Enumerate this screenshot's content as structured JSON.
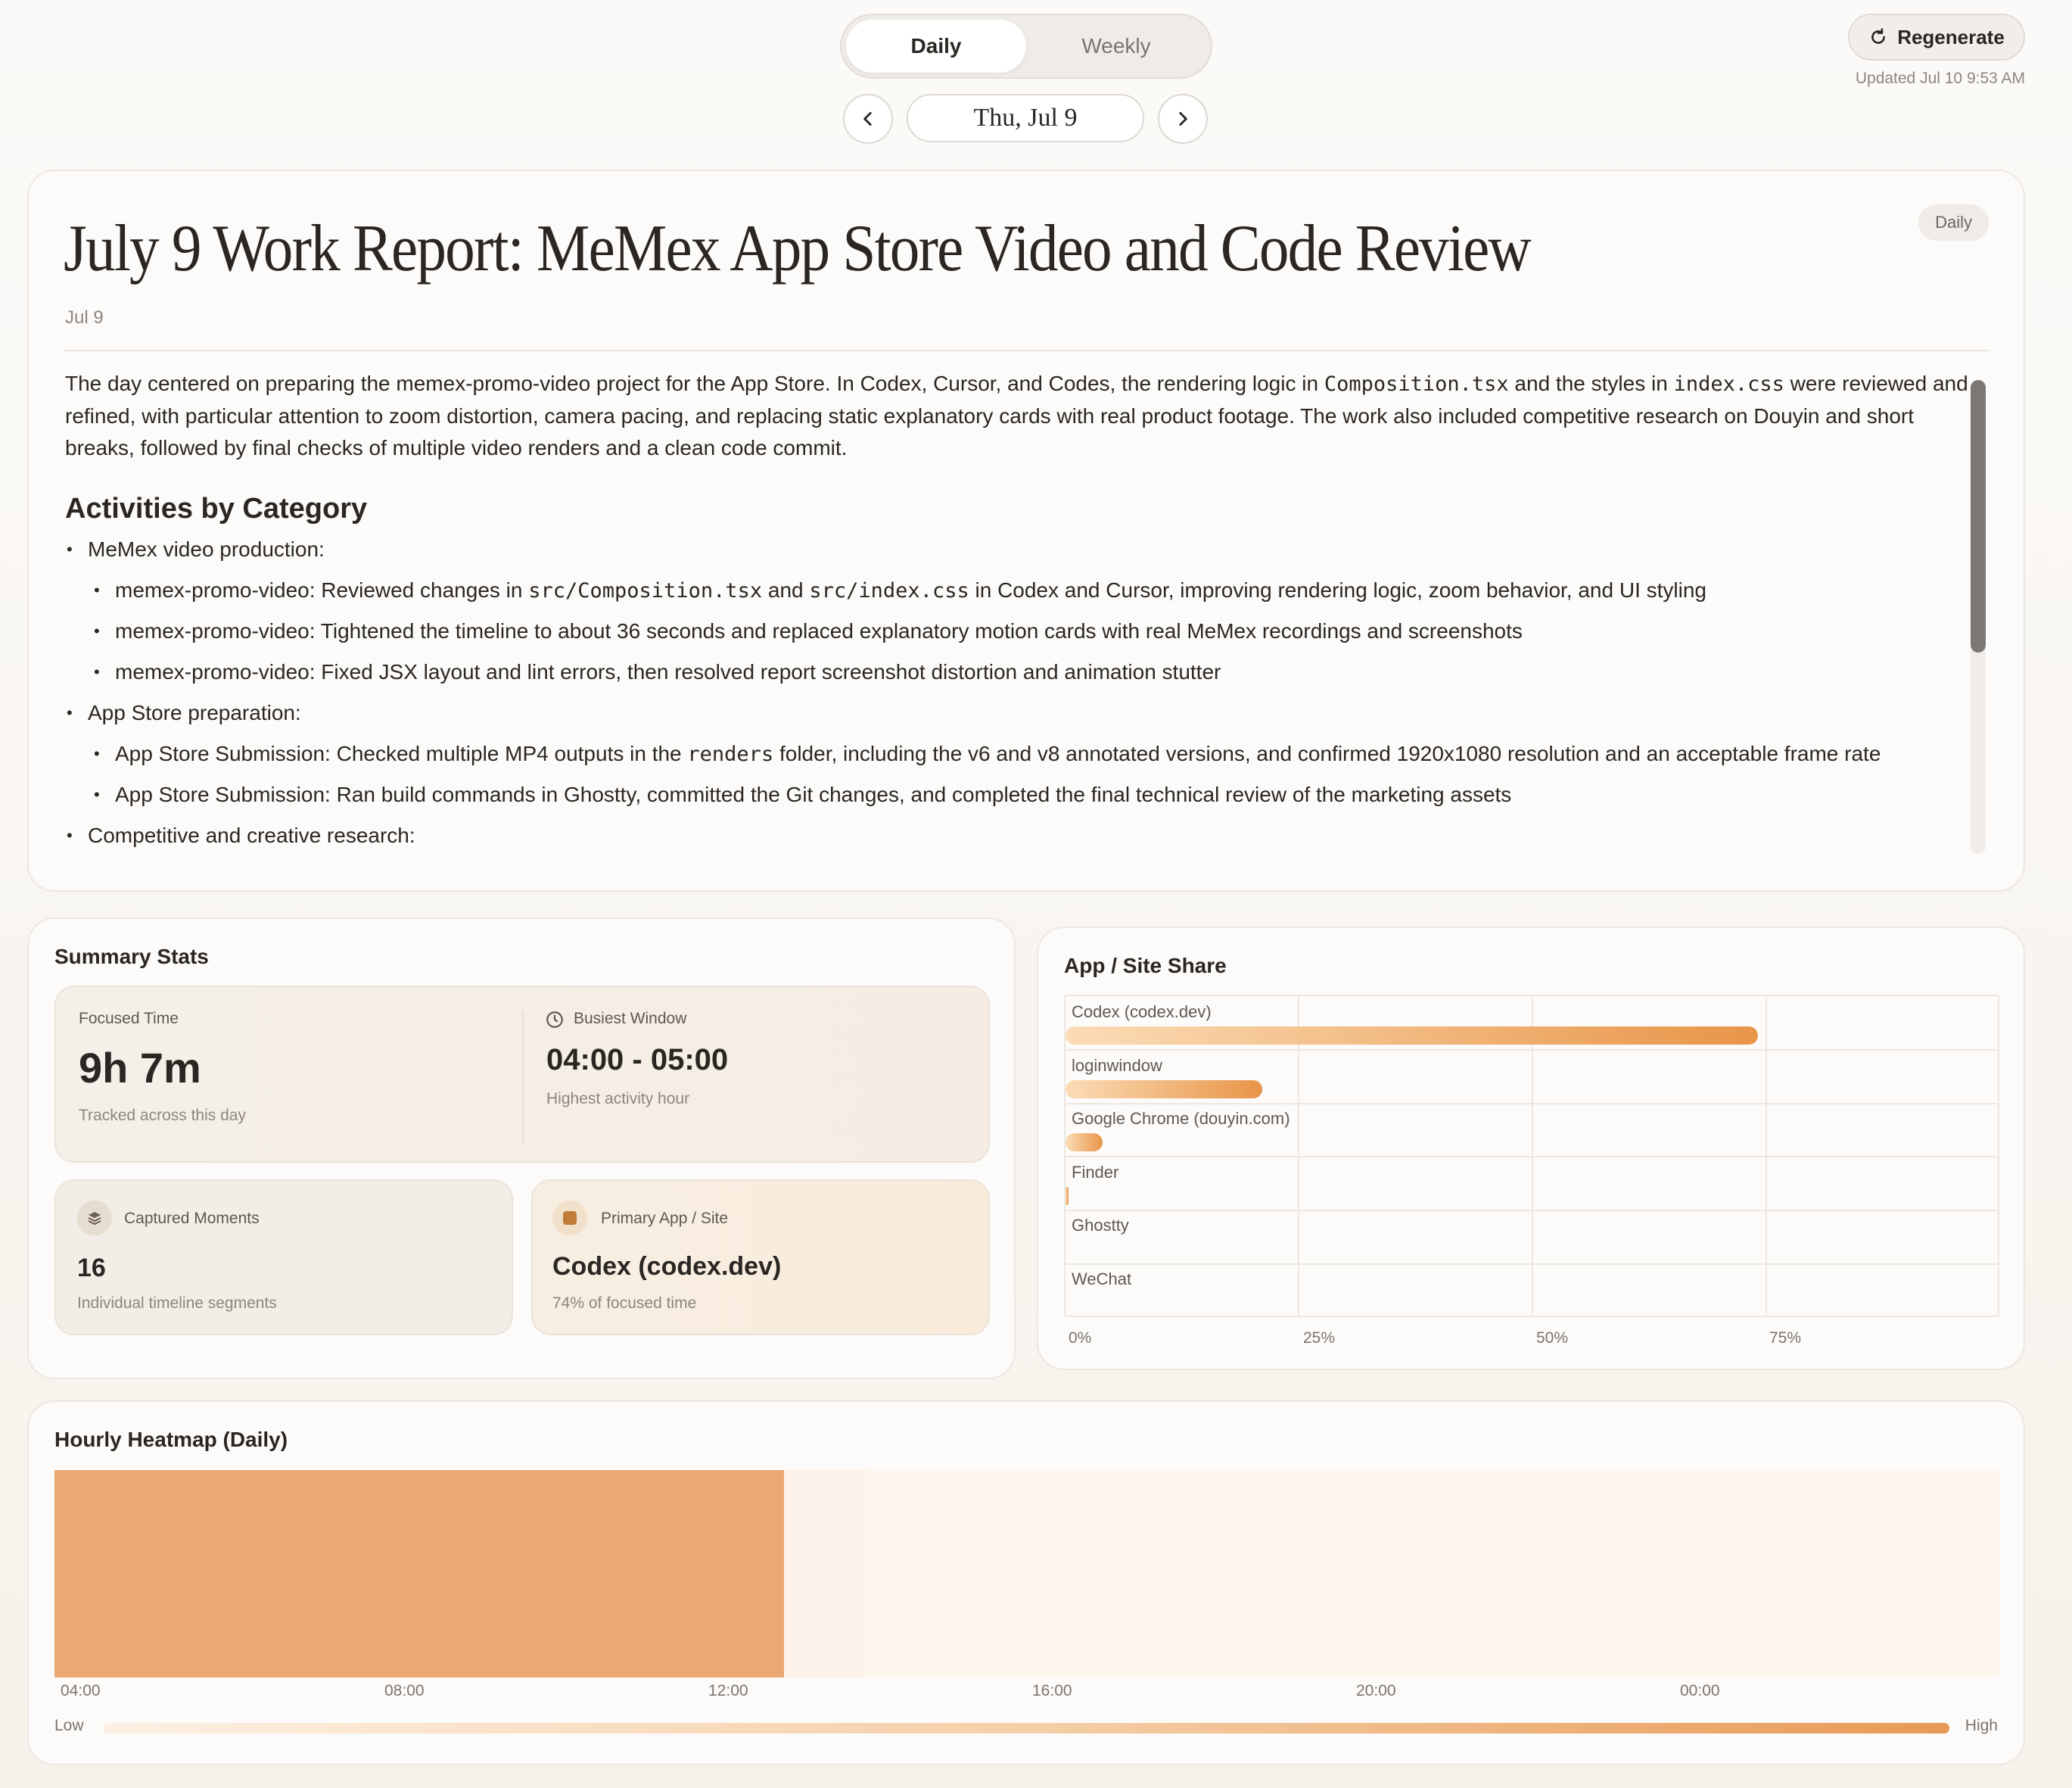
{
  "toggle": {
    "daily": "Daily",
    "weekly": "Weekly",
    "selected": "Daily"
  },
  "date_nav": {
    "label": "Thu, Jul 9",
    "prev_icon": "chevron-left-icon",
    "next_icon": "chevron-right-icon"
  },
  "regenerate": {
    "label": "Regenerate",
    "icon": "refresh-icon",
    "updated": "Updated Jul 10 9:53 AM"
  },
  "report": {
    "title": "July 9 Work Report: MeMex App Store Video and Code Review",
    "badge": "Daily",
    "date": "Jul 9",
    "summary": {
      "p1": "The day centered on preparing the memex-promo-video project for the App Store. In Codex, Cursor, and Codes, the rendering logic in ",
      "code1": "Composition.tsx",
      "p2": " and the styles in ",
      "code2": "index.css",
      "p3": " were reviewed and refined, with particular attention to zoom distortion, camera pacing, and replacing static explanatory cards with real product footage. The work also included competitive research on Douyin and short breaks, followed by final checks of multiple video renders and a clean code commit."
    },
    "activities_heading": "Activities by Category",
    "cat1": "MeMex video production:",
    "item1": {
      "a": "memex-promo-video: Reviewed changes in ",
      "code_a": "src/Composition.tsx",
      "b": " and ",
      "code_b": "src/index.css",
      "c": " in Codex and Cursor, improving rendering logic, zoom behavior, and UI styling"
    },
    "item2": "memex-promo-video: Tightened the timeline to about 36 seconds and replaced explanatory motion cards with real MeMex recordings and screenshots",
    "item3": "memex-promo-video: Fixed JSX layout and lint errors, then resolved report screenshot distortion and animation stutter",
    "cat2": "App Store preparation:",
    "item4": {
      "a": "App Store Submission: Checked multiple MP4 outputs in the ",
      "code_a": "renders",
      "b": " folder, including the v6 and v8 annotated versions, and confirmed 1920x1080 resolution and an acceptable frame rate"
    },
    "item5": "App Store Submission: Ran build commands in Ghostty, committed the Git changes, and completed the final technical review of the marketing assets",
    "cat3": "Competitive and creative research:"
  },
  "summary_stats": {
    "title": "Summary Stats",
    "focused": {
      "label": "Focused Time",
      "value": "9h 7m",
      "sub": "Tracked across this day"
    },
    "busiest": {
      "label": "Busiest Window",
      "value": "04:00 - 05:00",
      "sub": "Highest activity hour",
      "icon": "clock-icon"
    },
    "captured": {
      "label": "Captured Moments",
      "value": "16",
      "sub": "Individual timeline segments",
      "icon": "layers-icon"
    },
    "primary": {
      "label": "Primary App / Site",
      "value": "Codex (codex.dev)",
      "sub": "74% of focused time",
      "icon": "app-square-icon"
    }
  },
  "app_share": {
    "title": "App / Site Share",
    "apps": [
      {
        "name": "Codex (codex.dev)",
        "share": 74
      },
      {
        "name": "loginwindow",
        "share": 21
      },
      {
        "name": "Google Chrome (douyin.com)",
        "share": 4
      },
      {
        "name": "Finder",
        "share": 0.3
      },
      {
        "name": "Ghostty",
        "share": 0
      },
      {
        "name": "WeChat",
        "share": 0
      }
    ],
    "ticks": [
      "0%",
      "25%",
      "50%",
      "75%"
    ]
  },
  "heatmap": {
    "title": "Hourly Heatmap (Daily)",
    "ticks": [
      "04:00",
      "08:00",
      "12:00",
      "16:00",
      "20:00",
      "00:00"
    ],
    "legend_low": "Low",
    "legend_high": "High",
    "colors": {
      "high": "#eba873",
      "low": "#fdf3ea",
      "empty": "#fdf6ef"
    },
    "hours": [
      {
        "hour": "04:00",
        "level": 1
      },
      {
        "hour": "05:00",
        "level": 1
      },
      {
        "hour": "06:00",
        "level": 1
      },
      {
        "hour": "07:00",
        "level": 1
      },
      {
        "hour": "08:00",
        "level": 1
      },
      {
        "hour": "09:00",
        "level": 1
      },
      {
        "hour": "10:00",
        "level": 1
      },
      {
        "hour": "11:00",
        "level": 1
      },
      {
        "hour": "12:00",
        "level": 1
      },
      {
        "hour": "13:00",
        "level": 0.1
      }
    ]
  }
}
